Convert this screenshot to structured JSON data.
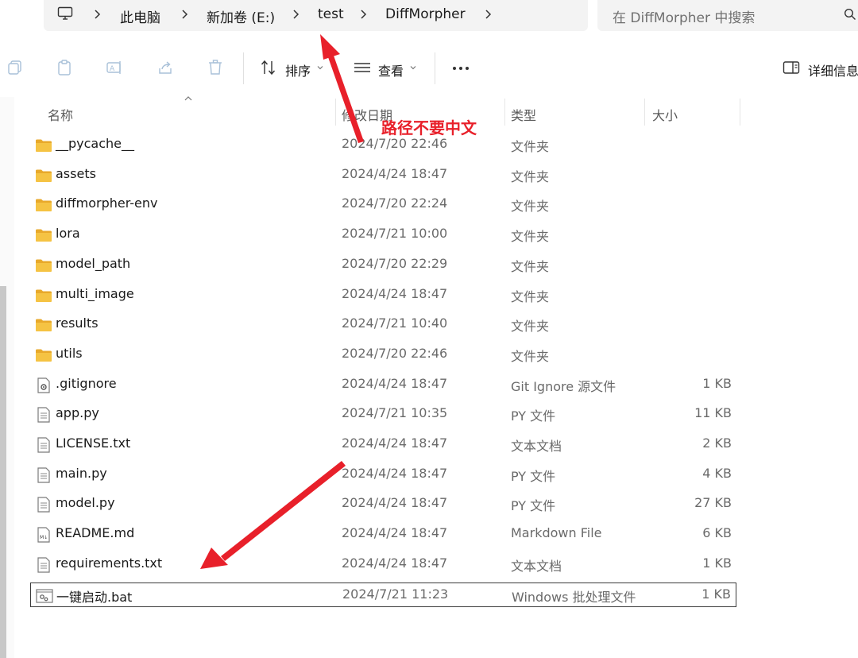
{
  "breadcrumb": {
    "items": [
      "此电脑",
      "新加卷 (E:)",
      "test",
      "DiffMorpher"
    ]
  },
  "search": {
    "placeholder": "在 DiffMorpher 中搜索"
  },
  "toolbar": {
    "sort_label": "排序",
    "view_label": "查看",
    "details_label": "详细信息"
  },
  "columns": {
    "name": "名称",
    "modified": "修改日期",
    "type": "类型",
    "size": "大小"
  },
  "files": [
    {
      "name": "__pycache__",
      "date": "2024/7/20 22:46",
      "type": "文件夹",
      "size": "",
      "kind": "folder"
    },
    {
      "name": "assets",
      "date": "2024/4/24 18:47",
      "type": "文件夹",
      "size": "",
      "kind": "folder"
    },
    {
      "name": "diffmorpher-env",
      "date": "2024/7/20 22:24",
      "type": "文件夹",
      "size": "",
      "kind": "folder"
    },
    {
      "name": "lora",
      "date": "2024/7/21 10:00",
      "type": "文件夹",
      "size": "",
      "kind": "folder"
    },
    {
      "name": "model_path",
      "date": "2024/7/20 22:29",
      "type": "文件夹",
      "size": "",
      "kind": "folder"
    },
    {
      "name": "multi_image",
      "date": "2024/4/24 18:47",
      "type": "文件夹",
      "size": "",
      "kind": "folder"
    },
    {
      "name": "results",
      "date": "2024/7/21 10:40",
      "type": "文件夹",
      "size": "",
      "kind": "folder"
    },
    {
      "name": "utils",
      "date": "2024/7/20 22:46",
      "type": "文件夹",
      "size": "",
      "kind": "folder"
    },
    {
      "name": ".gitignore",
      "date": "2024/4/24 18:47",
      "type": "Git Ignore 源文件",
      "size": "1 KB",
      "kind": "config"
    },
    {
      "name": "app.py",
      "date": "2024/7/21 10:35",
      "type": "PY 文件",
      "size": "11 KB",
      "kind": "doc"
    },
    {
      "name": "LICENSE.txt",
      "date": "2024/4/24 18:47",
      "type": "文本文档",
      "size": "2 KB",
      "kind": "doc"
    },
    {
      "name": "main.py",
      "date": "2024/4/24 18:47",
      "type": "PY 文件",
      "size": "4 KB",
      "kind": "doc"
    },
    {
      "name": "model.py",
      "date": "2024/4/24 18:47",
      "type": "PY 文件",
      "size": "27 KB",
      "kind": "doc"
    },
    {
      "name": "README.md",
      "date": "2024/4/24 18:47",
      "type": "Markdown File",
      "size": "6 KB",
      "kind": "markdown"
    },
    {
      "name": "requirements.txt",
      "date": "2024/4/24 18:47",
      "type": "文本文档",
      "size": "1 KB",
      "kind": "doc"
    },
    {
      "name": "一键启动.bat",
      "date": "2024/7/21 11:23",
      "type": "Windows 批处理文件",
      "size": "1 KB",
      "kind": "bat",
      "selected": true
    }
  ],
  "annotation": {
    "text": "路径不要中文",
    "color": "#e8202a"
  },
  "colors": {
    "folder": "#f5c343",
    "folder_dark": "#e8a92b",
    "bar_bg": "#f3f3f3"
  }
}
